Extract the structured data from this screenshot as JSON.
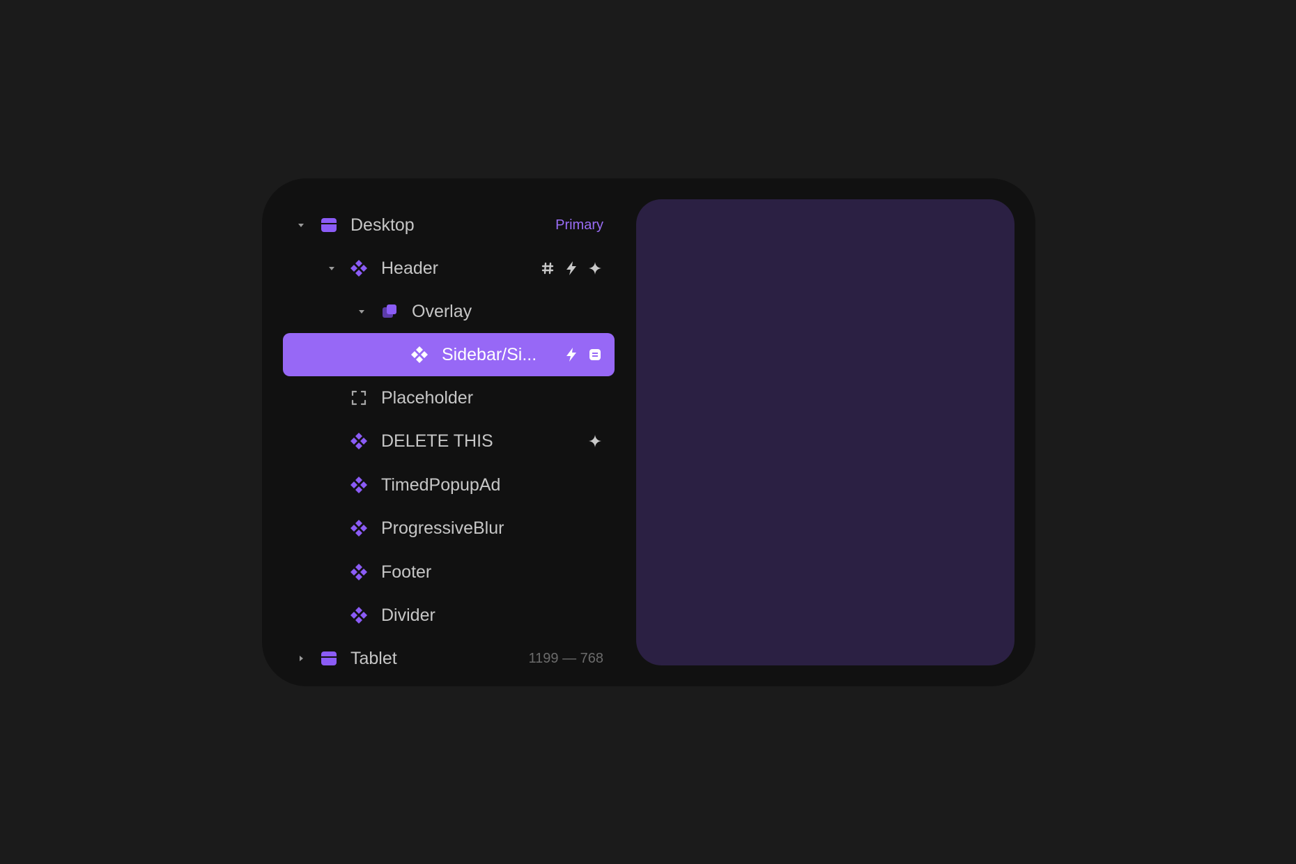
{
  "layers": {
    "desktop": {
      "label": "Desktop",
      "badge": "Primary"
    },
    "header": {
      "label": "Header"
    },
    "overlay": {
      "label": "Overlay"
    },
    "sidebar": {
      "label": "Sidebar/Si..."
    },
    "placeholder": {
      "label": "Placeholder"
    },
    "delete_this": {
      "label": "DELETE THIS"
    },
    "timed_popup": {
      "label": "TimedPopupAd"
    },
    "progressive_blur": {
      "label": "ProgressiveBlur"
    },
    "footer": {
      "label": "Footer"
    },
    "divider": {
      "label": "Divider"
    },
    "tablet": {
      "label": "Tablet",
      "size": "1199 — 768"
    }
  },
  "icons": {
    "breakpoint": "breakpoint-icon",
    "component": "component-icon",
    "overlay": "overlay-icon",
    "placeholder": "frame-icon",
    "grid": "hash-icon",
    "interaction": "lightning-icon",
    "effect": "sparkle-icon",
    "variable": "variable-icon"
  },
  "colors": {
    "background": "#1b1b1b",
    "panel": "#111111",
    "preview": "#2b2043",
    "accent": "#9768f6",
    "icon_purple": "#8b5cf6"
  }
}
